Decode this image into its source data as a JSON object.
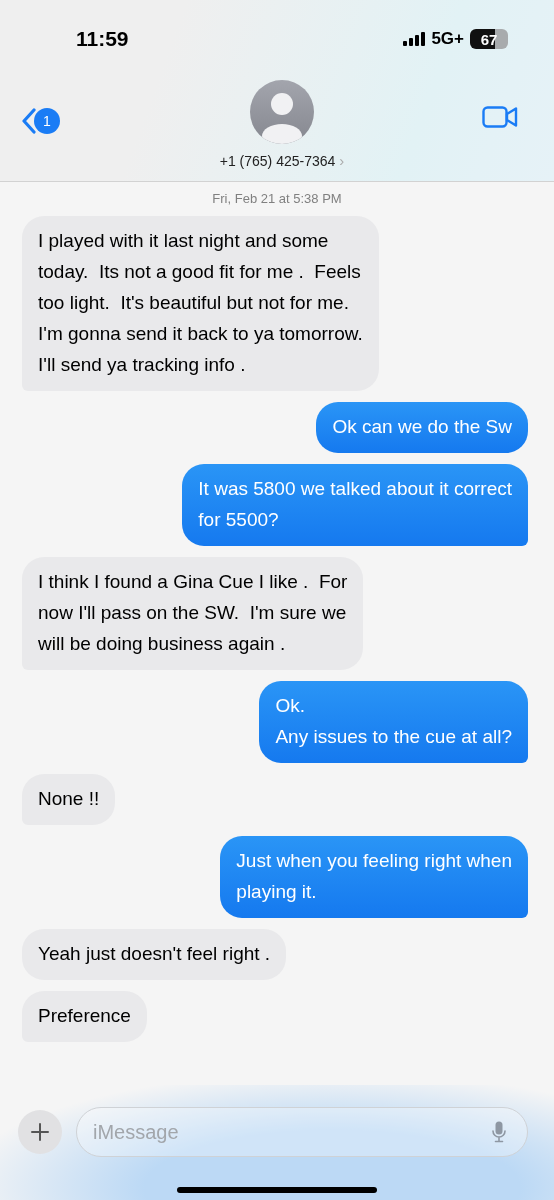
{
  "status_bar": {
    "time": "11:59",
    "network": "5G+",
    "battery": "67"
  },
  "header": {
    "back_badge": "1",
    "contact": "+1 (765) 425-7364",
    "chevron": "›"
  },
  "timestamp": "Fri, Feb 21 at 5:38 PM",
  "messages": [
    {
      "kind": "received",
      "tail": true,
      "text": "I played with it last night and some\ntoday.  Its not a good fit for me .  Feels\ntoo light.  It's beautiful but not for me.\nI'm gonna send it back to ya tomorrow.\nI'll send ya tracking info ."
    },
    {
      "kind": "sent",
      "tail": false,
      "text": "Ok can we do the Sw"
    },
    {
      "kind": "sent",
      "tail": true,
      "text": "It was 5800 we talked about it correct\nfor 5500?"
    },
    {
      "kind": "received",
      "tail": true,
      "text": "I think I found a Gina Cue I like .  For\nnow I'll pass on the SW.  I'm sure we\nwill be doing business again ."
    },
    {
      "kind": "sent",
      "tail": true,
      "text": "Ok.\nAny issues to the cue at all?"
    },
    {
      "kind": "received",
      "tail": true,
      "text": "None !!"
    },
    {
      "kind": "sent",
      "tail": true,
      "text": "Just when you feeling right when\nplaying it."
    },
    {
      "kind": "received",
      "tail": false,
      "text": "Yeah just doesn't feel right ."
    },
    {
      "kind": "received",
      "tail": true,
      "text": "Preference"
    }
  ],
  "composer": {
    "placeholder": "iMessage"
  }
}
